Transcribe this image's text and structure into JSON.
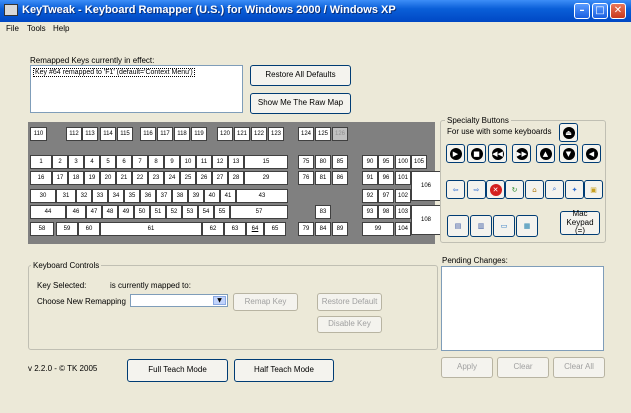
{
  "window": {
    "title": "KeyTweak -  Keyboard Remapper (U.S.)  for Windows 2000 / Windows XP"
  },
  "menu": [
    "File",
    "Tools",
    "Help"
  ],
  "remapped": {
    "heading": "Remapped Keys currently in effect:",
    "items": [
      "Key #64 remapped to 'F1' (default='Context Menu')"
    ]
  },
  "buttons": {
    "restore_all": "Restore All Defaults",
    "raw_map": "Show Me The Raw Map",
    "remap_key": "Remap Key",
    "restore_default": "Restore Default",
    "disable_key": "Disable Key",
    "full_teach": "Full Teach Mode",
    "half_teach": "Half Teach Mode",
    "apply": "Apply",
    "clear": "Clear",
    "clear_all": "Clear All",
    "mac_keypad": "Mac Keypad (=)"
  },
  "keyboard": {
    "keys": [
      "110",
      "112",
      "113",
      "114",
      "115",
      "116",
      "117",
      "118",
      "119",
      "120",
      "121",
      "122",
      "123",
      "124",
      "125",
      "126",
      "1",
      "2",
      "3",
      "4",
      "5",
      "6",
      "7",
      "8",
      "9",
      "10",
      "11",
      "12",
      "13",
      "15",
      "75",
      "80",
      "85",
      "90",
      "95",
      "100",
      "105",
      "16",
      "17",
      "18",
      "19",
      "20",
      "21",
      "22",
      "23",
      "24",
      "25",
      "26",
      "27",
      "28",
      "29",
      "76",
      "81",
      "86",
      "91",
      "96",
      "101",
      "106",
      "30",
      "31",
      "32",
      "33",
      "34",
      "35",
      "36",
      "37",
      "38",
      "39",
      "40",
      "41",
      "43",
      "92",
      "97",
      "102",
      "44",
      "46",
      "47",
      "48",
      "49",
      "50",
      "51",
      "52",
      "53",
      "54",
      "55",
      "57",
      "83",
      "93",
      "98",
      "103",
      "108",
      "58",
      "59",
      "60",
      "61",
      "62",
      "63",
      "64",
      "65",
      "79",
      "84",
      "89",
      "99",
      "104"
    ]
  },
  "specialty": {
    "title": "Specialty Buttons",
    "subtitle": "For use with some keyboards",
    "icons": [
      "eject-icon",
      "play-icon",
      "stop-icon",
      "previous-track-icon",
      "next-track-icon",
      "volume-up-icon",
      "volume-down-icon",
      "mute-icon",
      "back-arrow-icon",
      "forward-arrow-icon",
      "stop-web-icon",
      "refresh-icon",
      "home-icon",
      "search-web-icon",
      "favorites-icon",
      "folder-icon",
      "calculator-icon",
      "my-computer-icon",
      "monitor-icon",
      "spreadsheet-icon"
    ]
  },
  "controls": {
    "title": "Keyboard Controls",
    "key_selected": "Key Selected:",
    "mapped_to": "is currently mapped to:",
    "choose": "Choose New Remapping",
    "select_value": ""
  },
  "pending": {
    "title": "Pending Changes:"
  },
  "version": "v 2.2.0 - © TK 2005",
  "colors": {
    "titlebar": "#0a5fd8",
    "window_bg": "#ece9d8",
    "keyboard_bg": "#808080"
  }
}
